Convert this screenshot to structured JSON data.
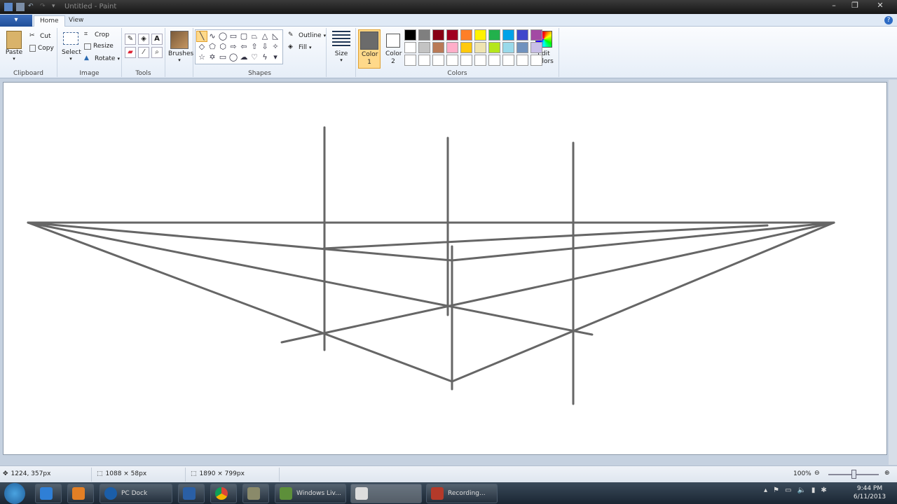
{
  "window": {
    "title": "Untitled - Paint",
    "minimize": "–",
    "maximize": "❐",
    "close": "✕"
  },
  "tabs": {
    "menu": "▾",
    "home": "Home",
    "view": "View"
  },
  "clipboard": {
    "paste": "Paste",
    "cut": "Cut",
    "copy": "Copy",
    "label": "Clipboard"
  },
  "image": {
    "select": "Select",
    "crop": "Crop",
    "resize": "Resize",
    "rotate": "Rotate",
    "label": "Image"
  },
  "tools": {
    "label": "Tools",
    "text_tool": "A"
  },
  "brushes": {
    "label": "Brushes"
  },
  "shapes": {
    "outline": "Outline",
    "fill": "Fill",
    "label": "Shapes"
  },
  "size": {
    "label": "Size"
  },
  "colors": {
    "color1": "Color 1",
    "color2": "Color 2",
    "edit": "Edit colors",
    "label": "Colors",
    "color1_value": "#6b6b6b",
    "color2_value": "#ffffff",
    "palette": [
      "#000000",
      "#7f7f7f",
      "#880015",
      "#a00020",
      "#ff7f27",
      "#fff200",
      "#22b14c",
      "#00a2e8",
      "#3f48cc",
      "#a349a4",
      "#ffffff",
      "#c3c3c3",
      "#b97a57",
      "#ffaec9",
      "#ffc90e",
      "#efe4b0",
      "#b5e61d",
      "#99d9ea",
      "#7092be",
      "#c8bfe7",
      "#ffffff",
      "#ffffff",
      "#ffffff",
      "#ffffff",
      "#ffffff",
      "#ffffff",
      "#ffffff",
      "#ffffff",
      "#ffffff",
      "#ffffff"
    ]
  },
  "status": {
    "cursor": "1224, 357px",
    "selection": "1088 × 58px",
    "canvas_size": "1890 × 799px",
    "zoom": "100%"
  },
  "taskbar": {
    "items": [
      {
        "label": "PC Dock"
      },
      {
        "label": ""
      },
      {
        "label": ""
      },
      {
        "label": ""
      },
      {
        "label": "Windows Liv..."
      },
      {
        "label": ""
      },
      {
        "label": "Recording..."
      }
    ],
    "time": "9:44 PM",
    "date": "6/11/2013"
  },
  "drawing": {
    "stroke_color": "#666666",
    "lines": [
      [
        40,
        318,
        1190,
        318
      ],
      [
        40,
        318,
        645,
        372
      ],
      [
        645,
        372,
        1190,
        318
      ],
      [
        40,
        318,
        845,
        478
      ],
      [
        402,
        489,
        1190,
        318
      ],
      [
        40,
        318,
        645,
        545
      ],
      [
        645,
        545,
        1190,
        318
      ],
      [
        462,
        355,
        1095,
        322
      ],
      [
        463,
        182,
        463,
        500
      ],
      [
        639,
        197,
        639,
        450
      ],
      [
        645,
        352,
        645,
        556
      ],
      [
        818,
        204,
        818,
        577
      ]
    ]
  }
}
